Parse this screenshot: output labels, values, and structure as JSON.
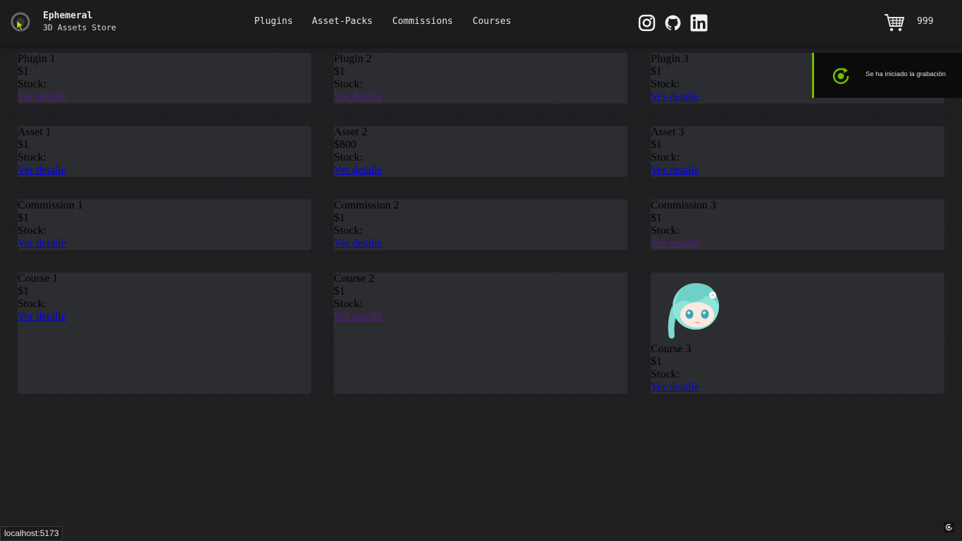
{
  "header": {
    "brand_name": "Ephemeral",
    "brand_sub": "3D Assets Store",
    "nav": [
      "Plugins",
      "Asset-Packs",
      "Commissions",
      "Courses"
    ],
    "social_icons": [
      "instagram-icon",
      "github-icon",
      "linkedin-icon"
    ],
    "cart_count": "999"
  },
  "products": [
    {
      "name": "Plugin 1",
      "price": "$1",
      "stock": "Stock:",
      "link": "Ver detalle"
    },
    {
      "name": "Plugin 2",
      "price": "$1",
      "stock": "Stock:",
      "link": "Ver detalle"
    },
    {
      "name": "Plugin 3",
      "price": "$1",
      "stock": "Stock:",
      "link": "Ver detalle"
    },
    {
      "name": "Asset 1",
      "price": "$1",
      "stock": "Stock:",
      "link": "Ver detalle"
    },
    {
      "name": "Asset 2",
      "price": "$800",
      "stock": "Stock:",
      "link": "Ver detalle"
    },
    {
      "name": "Asset 3",
      "price": "$1",
      "stock": "Stock:",
      "link": "Ver detalle"
    },
    {
      "name": "Commission 1",
      "price": "$1",
      "stock": "Stock:",
      "link": "Ver detalle"
    },
    {
      "name": "Commission 2",
      "price": "$1",
      "stock": "Stock:",
      "link": "Ver detalle"
    },
    {
      "name": "Commission 3",
      "price": "$1",
      "stock": "Stock:",
      "link": "Ver detalle"
    },
    {
      "name": "Course 1",
      "price": "$1",
      "stock": "Stock:",
      "link": "Ver detalle"
    },
    {
      "name": "Course 2",
      "price": "$1",
      "stock": "Stock:",
      "link": "Ver detalle"
    },
    {
      "name": "Course 3",
      "price": "$1",
      "stock": "Stock:",
      "link": "Ver detalle"
    }
  ],
  "toast": {
    "text": "Se ha iniciado la grabación"
  },
  "status_bar": {
    "url": "localhost:5173"
  },
  "colors": {
    "accent": "#76b900",
    "link": "#0000ee",
    "link_visited": "#551a8b",
    "card_bg": "#2c2d30"
  }
}
